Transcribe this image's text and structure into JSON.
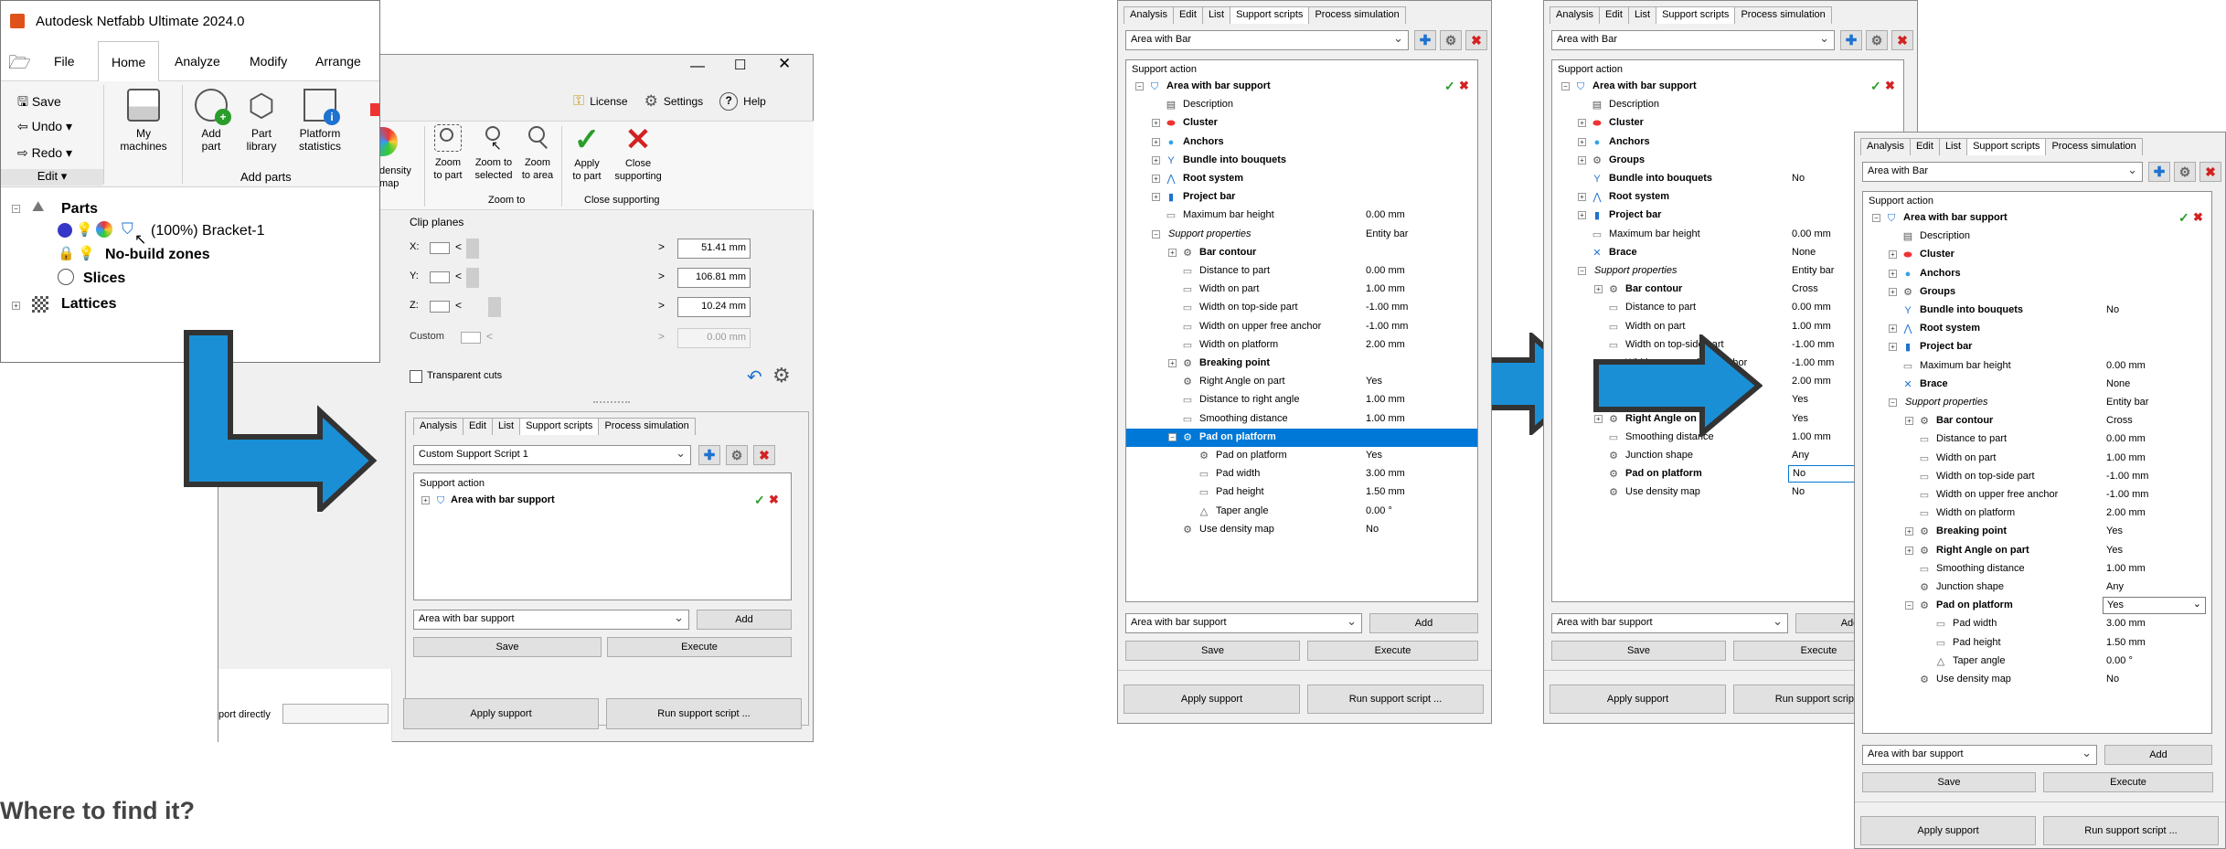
{
  "app": {
    "title": "Autodesk Netfabb Ultimate 2024.0",
    "menu": [
      "File",
      "Home",
      "Analyze",
      "Modify",
      "Arrange"
    ],
    "active_menu": "Home",
    "save": "Save",
    "undo": "Undo",
    "redo": "Redo",
    "edit_group": "Edit",
    "my_machines": "My\nmachines",
    "add_part": "Add\npart",
    "part_library": "Part\nlibrary",
    "platform_statistics": "Platform\nstatistics",
    "add_parts_group": "Add parts",
    "tree": {
      "parts": "Parts",
      "bracket": "(100%) Bracket-1",
      "no_build": "No-build zones",
      "slices": "Slices",
      "lattices": "Lattices"
    }
  },
  "support_window": {
    "license": "License",
    "settings": "Settings",
    "help": "Help",
    "density_map": "density\nmap",
    "zoom_to_part": "Zoom\nto part",
    "zoom_to_selected": "Zoom to\nselected",
    "zoom_to_area": "Zoom\nto area",
    "zoom_to_group": "Zoom to",
    "apply_to_part": "Apply\nto part",
    "close_supporting": "Close\nsupporting",
    "close_group": "Close supporting",
    "clip_planes": "Clip planes",
    "x_label": "X:",
    "y_label": "Y:",
    "z_label": "Z:",
    "x_value": "51.41 mm",
    "y_value": "106.81 mm",
    "z_value": "10.24 mm",
    "custom_label": "Custom",
    "custom_value": "0.00 mm",
    "transparent_cuts": "Transparent cuts",
    "tabs": [
      "Analysis",
      "Edit",
      "List",
      "Support scripts",
      "Process simulation"
    ],
    "script_combo": "Custom Support Script 1",
    "support_action": "Support action",
    "area_with_bar_support": "Area with bar support",
    "add_combo": "Area with bar support",
    "add": "Add",
    "save": "Save",
    "execute": "Execute",
    "apply_support": "Apply support",
    "run_support_script": "Run support script ...",
    "support_directly": "port directly"
  },
  "caption": "Where to find it?",
  "panel1": {
    "tabs": [
      "Analysis",
      "Edit",
      "List",
      "Support scripts",
      "Process simulation"
    ],
    "combo": "Area with Bar",
    "support_action": "Support action",
    "rows": [
      {
        "indent": 0,
        "exp": "−",
        "icon": "bar",
        "bold": true,
        "label": "Area with bar support",
        "value": ""
      },
      {
        "indent": 1,
        "exp": "",
        "icon": "text",
        "bold": false,
        "label": "Description",
        "value": ""
      },
      {
        "indent": 1,
        "exp": "+",
        "icon": "cluster",
        "bold": true,
        "label": "Cluster",
        "value": ""
      },
      {
        "indent": 1,
        "exp": "+",
        "icon": "anchor",
        "bold": true,
        "label": "Anchors",
        "value": ""
      },
      {
        "indent": 1,
        "exp": "+",
        "icon": "bundle",
        "bold": true,
        "label": "Bundle into bouquets",
        "value": ""
      },
      {
        "indent": 1,
        "exp": "+",
        "icon": "root",
        "bold": true,
        "label": "Root system",
        "value": ""
      },
      {
        "indent": 1,
        "exp": "+",
        "icon": "project",
        "bold": true,
        "label": "Project bar",
        "value": ""
      },
      {
        "indent": 1,
        "exp": "",
        "icon": "field",
        "bold": false,
        "label": "Maximum bar height",
        "value": "0.00 mm"
      },
      {
        "indent": 1,
        "exp": "−",
        "icon": "",
        "bold": false,
        "italic": true,
        "label": "Support properties",
        "value": "Entity bar"
      },
      {
        "indent": 2,
        "exp": "+",
        "icon": "gear",
        "bold": true,
        "label": "Bar contour",
        "value": ""
      },
      {
        "indent": 2,
        "exp": "",
        "icon": "field",
        "bold": false,
        "label": "Distance to part",
        "value": "0.00 mm"
      },
      {
        "indent": 2,
        "exp": "",
        "icon": "field",
        "bold": false,
        "label": "Width on part",
        "value": "1.00 mm"
      },
      {
        "indent": 2,
        "exp": "",
        "icon": "field",
        "bold": false,
        "label": "Width on top-side part",
        "value": "-1.00 mm"
      },
      {
        "indent": 2,
        "exp": "",
        "icon": "field",
        "bold": false,
        "label": "Width on upper free anchor",
        "value": "-1.00 mm"
      },
      {
        "indent": 2,
        "exp": "",
        "icon": "field",
        "bold": false,
        "label": "Width on platform",
        "value": "2.00 mm"
      },
      {
        "indent": 2,
        "exp": "+",
        "icon": "gear",
        "bold": true,
        "label": "Breaking point",
        "value": ""
      },
      {
        "indent": 2,
        "exp": "",
        "icon": "gear",
        "bold": false,
        "label": "Right Angle on part",
        "value": "Yes"
      },
      {
        "indent": 2,
        "exp": "",
        "icon": "field",
        "bold": false,
        "label": "Distance to right angle",
        "value": "1.00 mm"
      },
      {
        "indent": 2,
        "exp": "",
        "icon": "field",
        "bold": false,
        "label": "Smoothing distance",
        "value": "1.00 mm"
      },
      {
        "indent": 2,
        "exp": "−",
        "icon": "gear",
        "bold": true,
        "label": "Pad on platform",
        "value": "",
        "selected": true
      },
      {
        "indent": 3,
        "exp": "",
        "icon": "gear",
        "bold": false,
        "label": "Pad on platform",
        "value": "Yes"
      },
      {
        "indent": 3,
        "exp": "",
        "icon": "field",
        "bold": false,
        "label": "Pad width",
        "value": "3.00 mm"
      },
      {
        "indent": 3,
        "exp": "",
        "icon": "field",
        "bold": false,
        "label": "Pad height",
        "value": "1.50 mm"
      },
      {
        "indent": 3,
        "exp": "",
        "icon": "angle",
        "bold": false,
        "label": "Taper angle",
        "value": "0.00 °"
      },
      {
        "indent": 2,
        "exp": "",
        "icon": "gear",
        "bold": false,
        "label": "Use density map",
        "value": "No"
      }
    ],
    "add_combo": "Area with bar support",
    "add": "Add",
    "save": "Save",
    "execute": "Execute",
    "apply_support": "Apply support",
    "run_support_script": "Run support script ..."
  },
  "panel2": {
    "tabs": [
      "Analysis",
      "Edit",
      "List",
      "Support scripts",
      "Process simulation"
    ],
    "combo": "Area with Bar",
    "support_action": "Support action",
    "rows": [
      {
        "indent": 0,
        "exp": "−",
        "icon": "bar",
        "bold": true,
        "label": "Area with bar support",
        "value": ""
      },
      {
        "indent": 1,
        "exp": "",
        "icon": "text",
        "bold": false,
        "label": "Description",
        "value": ""
      },
      {
        "indent": 1,
        "exp": "+",
        "icon": "cluster",
        "bold": true,
        "label": "Cluster",
        "value": ""
      },
      {
        "indent": 1,
        "exp": "+",
        "icon": "anchor",
        "bold": true,
        "label": "Anchors",
        "value": ""
      },
      {
        "indent": 1,
        "exp": "+",
        "icon": "gear",
        "bold": true,
        "label": "Groups",
        "value": ""
      },
      {
        "indent": 1,
        "exp": "",
        "icon": "bundle",
        "bold": true,
        "label": "Bundle into bouquets",
        "value": "No"
      },
      {
        "indent": 1,
        "exp": "+",
        "icon": "root",
        "bold": true,
        "label": "Root system",
        "value": ""
      },
      {
        "indent": 1,
        "exp": "+",
        "icon": "project",
        "bold": true,
        "label": "Project bar",
        "value": ""
      },
      {
        "indent": 1,
        "exp": "",
        "icon": "field",
        "bold": false,
        "label": "Maximum bar height",
        "value": "0.00 mm"
      },
      {
        "indent": 1,
        "exp": "",
        "icon": "brace",
        "bold": true,
        "label": "Brace",
        "value": "None"
      },
      {
        "indent": 1,
        "exp": "−",
        "icon": "",
        "bold": false,
        "italic": true,
        "label": "Support properties",
        "value": "Entity bar"
      },
      {
        "indent": 2,
        "exp": "+",
        "icon": "gear",
        "bold": true,
        "label": "Bar contour",
        "value": "Cross"
      },
      {
        "indent": 2,
        "exp": "",
        "icon": "field",
        "bold": false,
        "label": "Distance to part",
        "value": "0.00 mm"
      },
      {
        "indent": 2,
        "exp": "",
        "icon": "field",
        "bold": false,
        "label": "Width on part",
        "value": "1.00 mm"
      },
      {
        "indent": 2,
        "exp": "",
        "icon": "field",
        "bold": false,
        "label": "Width on top-side part",
        "value": "-1.00 mm"
      },
      {
        "indent": 2,
        "exp": "",
        "icon": "field",
        "bold": false,
        "label": "Width on upper free anchor",
        "value": "-1.00 mm"
      },
      {
        "indent": 2,
        "exp": "",
        "icon": "field",
        "bold": false,
        "label": "Width on platform",
        "value": "2.00 mm"
      },
      {
        "indent": 2,
        "exp": "+",
        "icon": "gear",
        "bold": true,
        "label": "Breaking point",
        "value": "Yes"
      },
      {
        "indent": 2,
        "exp": "+",
        "icon": "gear",
        "bold": true,
        "label": "Right Angle on part",
        "value": "Yes"
      },
      {
        "indent": 2,
        "exp": "",
        "icon": "field",
        "bold": false,
        "label": "Smoothing distance",
        "value": "1.00 mm"
      },
      {
        "indent": 2,
        "exp": "",
        "icon": "gear",
        "bold": false,
        "label": "Junction shape",
        "value": "Any"
      },
      {
        "indent": 2,
        "exp": "",
        "icon": "gear",
        "bold": true,
        "label": "Pad on platform",
        "value": "No",
        "editing": true
      },
      {
        "indent": 2,
        "exp": "",
        "icon": "gear",
        "bold": false,
        "label": "Use density map",
        "value": "No"
      }
    ],
    "add_combo": "Area with bar support",
    "add": "Add",
    "save": "Save",
    "execute": "Execute",
    "apply_support": "Apply support",
    "run_support_script": "Run support script ..."
  },
  "panel3": {
    "tabs": [
      "Analysis",
      "Edit",
      "List",
      "Support scripts",
      "Process simulation"
    ],
    "combo": "Area with Bar",
    "support_action": "Support action",
    "rows": [
      {
        "indent": 0,
        "exp": "−",
        "icon": "bar",
        "bold": true,
        "label": "Area with bar support",
        "value": ""
      },
      {
        "indent": 1,
        "exp": "",
        "icon": "text",
        "bold": false,
        "label": "Description",
        "value": ""
      },
      {
        "indent": 1,
        "exp": "+",
        "icon": "cluster",
        "bold": true,
        "label": "Cluster",
        "value": ""
      },
      {
        "indent": 1,
        "exp": "+",
        "icon": "anchor",
        "bold": true,
        "label": "Anchors",
        "value": ""
      },
      {
        "indent": 1,
        "exp": "+",
        "icon": "gear",
        "bold": true,
        "label": "Groups",
        "value": ""
      },
      {
        "indent": 1,
        "exp": "",
        "icon": "bundle",
        "bold": true,
        "label": "Bundle into bouquets",
        "value": "No"
      },
      {
        "indent": 1,
        "exp": "+",
        "icon": "root",
        "bold": true,
        "label": "Root system",
        "value": ""
      },
      {
        "indent": 1,
        "exp": "+",
        "icon": "project",
        "bold": true,
        "label": "Project bar",
        "value": ""
      },
      {
        "indent": 1,
        "exp": "",
        "icon": "field",
        "bold": false,
        "label": "Maximum bar height",
        "value": "0.00 mm"
      },
      {
        "indent": 1,
        "exp": "",
        "icon": "brace",
        "bold": true,
        "label": "Brace",
        "value": "None"
      },
      {
        "indent": 1,
        "exp": "−",
        "icon": "",
        "bold": false,
        "italic": true,
        "label": "Support properties",
        "value": "Entity bar"
      },
      {
        "indent": 2,
        "exp": "+",
        "icon": "gear",
        "bold": true,
        "label": "Bar contour",
        "value": "Cross"
      },
      {
        "indent": 2,
        "exp": "",
        "icon": "field",
        "bold": false,
        "label": "Distance to part",
        "value": "0.00 mm"
      },
      {
        "indent": 2,
        "exp": "",
        "icon": "field",
        "bold": false,
        "label": "Width on part",
        "value": "1.00 mm"
      },
      {
        "indent": 2,
        "exp": "",
        "icon": "field",
        "bold": false,
        "label": "Width on top-side part",
        "value": "-1.00 mm"
      },
      {
        "indent": 2,
        "exp": "",
        "icon": "field",
        "bold": false,
        "label": "Width on upper free anchor",
        "value": "-1.00 mm"
      },
      {
        "indent": 2,
        "exp": "",
        "icon": "field",
        "bold": false,
        "label": "Width on platform",
        "value": "2.00 mm"
      },
      {
        "indent": 2,
        "exp": "+",
        "icon": "gear",
        "bold": true,
        "label": "Breaking point",
        "value": "Yes"
      },
      {
        "indent": 2,
        "exp": "+",
        "icon": "gear",
        "bold": true,
        "label": "Right Angle on part",
        "value": "Yes"
      },
      {
        "indent": 2,
        "exp": "",
        "icon": "field",
        "bold": false,
        "label": "Smoothing distance",
        "value": "1.00 mm"
      },
      {
        "indent": 2,
        "exp": "",
        "icon": "gear",
        "bold": false,
        "label": "Junction shape",
        "value": "Any"
      },
      {
        "indent": 2,
        "exp": "−",
        "icon": "gear",
        "bold": true,
        "label": "Pad on platform",
        "value": "Yes",
        "dropdown": true
      },
      {
        "indent": 3,
        "exp": "",
        "icon": "field",
        "bold": false,
        "label": "Pad width",
        "value": "3.00 mm"
      },
      {
        "indent": 3,
        "exp": "",
        "icon": "field",
        "bold": false,
        "label": "Pad height",
        "value": "1.50 mm"
      },
      {
        "indent": 3,
        "exp": "",
        "icon": "angle",
        "bold": false,
        "label": "Taper angle",
        "value": "0.00 °"
      },
      {
        "indent": 2,
        "exp": "",
        "icon": "gear",
        "bold": false,
        "label": "Use density map",
        "value": "No"
      }
    ],
    "add_combo": "Area with bar support",
    "add": "Add",
    "save": "Save",
    "execute": "Execute",
    "apply_support": "Apply support",
    "run_support_script": "Run support script ..."
  },
  "colors": {
    "arrow_fill": "#1a8fd6",
    "arrow_stroke": "#333333",
    "selection": "#0078d7",
    "ok_green": "#2a9d2a",
    "cancel_red": "#d22222",
    "add_blue": "#1e72d0"
  }
}
